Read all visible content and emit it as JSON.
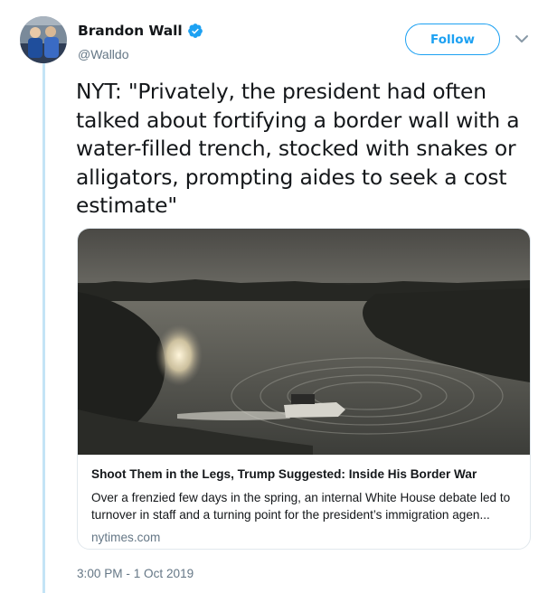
{
  "author": {
    "name": "Brandon Wall",
    "handle": "@Walldo",
    "verified": true
  },
  "actions": {
    "follow_label": "Follow"
  },
  "tweet": {
    "text": "NYT: \"Privately, the president had often talked about fortifying a border wall with a water-filled trench, stocked with snakes or alligators, prompting aides to seek a cost estimate\"",
    "timestamp": "3:00 PM - 1 Oct 2019"
  },
  "card": {
    "title": "Shoot Them in the Legs, Trump Suggested: Inside His Border War",
    "description": "Over a frenzied few days in the spring, an internal White House debate led to turnover in staff and a turning point for the president’s immigration agen...",
    "domain": "nytimes.com"
  },
  "colors": {
    "accent": "#1da1f2",
    "thread_line": "#c4e4f6",
    "secondary_text": "#657786",
    "card_border": "#e1e8ed"
  }
}
